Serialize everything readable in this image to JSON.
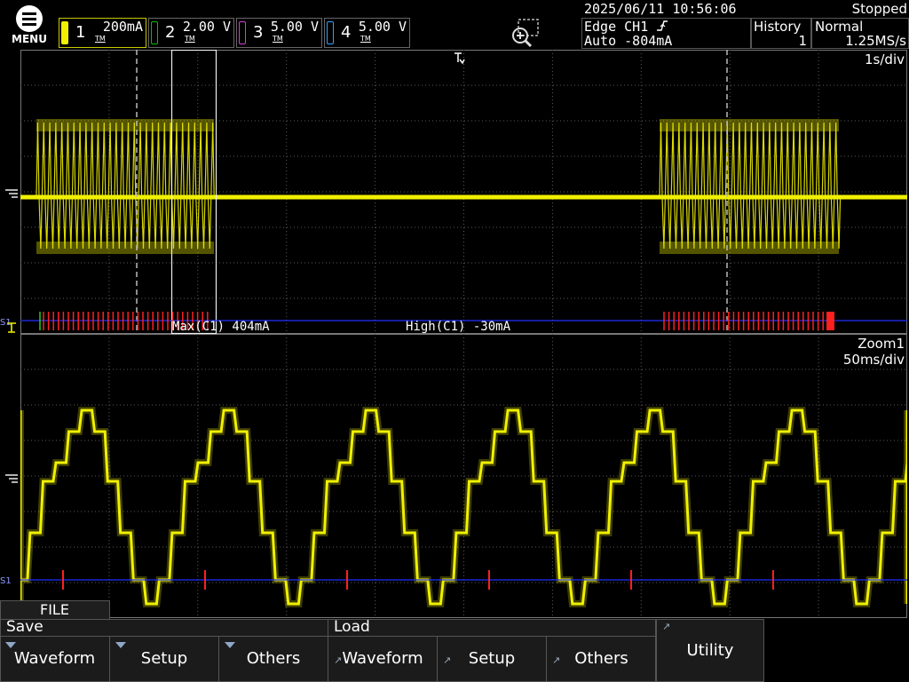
{
  "menu": {
    "label": "MENU"
  },
  "channels": [
    {
      "num": "1",
      "value": "200mA",
      "color": "#f0f000",
      "label": "TM"
    },
    {
      "num": "2",
      "value": "2.00 V",
      "color": "#00c000",
      "label": "TM"
    },
    {
      "num": "3",
      "value": "5.00 V",
      "color": "#d040d0",
      "label": "TM"
    },
    {
      "num": "4",
      "value": "5.00 V",
      "color": "#30a0ff",
      "label": "TM"
    }
  ],
  "datetime": "2025/06/11 10:56:06",
  "status": "Stopped",
  "trigger": {
    "line1": "Edge CH1",
    "line2": "Auto -804mA"
  },
  "history": {
    "label": "History",
    "value": "1"
  },
  "acq": {
    "mode": "Normal",
    "rate": "1.25MS/s"
  },
  "main": {
    "timebase": "1s/div"
  },
  "zoom": {
    "title": "Zoom1",
    "timebase": "50ms/div"
  },
  "measurements": {
    "max": "Max(C1)  404mA",
    "high": "High(C1) -30mA"
  },
  "markers": {
    "s1_top": "S1",
    "s1_bottom": "S1"
  },
  "colors": {
    "trace": "#f0f000",
    "bus": "#2030ff",
    "pulse": "#ff2020",
    "grid": "#5a5a5a",
    "bg": "#000000"
  },
  "softkeys": {
    "file_tab": "FILE",
    "save_group": "Save",
    "load_group": "Load",
    "save_waveform": "Waveform",
    "save_setup": "Setup",
    "save_others": "Others",
    "load_waveform": "Waveform",
    "load_setup": "Setup",
    "load_others": "Others",
    "utility": "Utility"
  }
}
